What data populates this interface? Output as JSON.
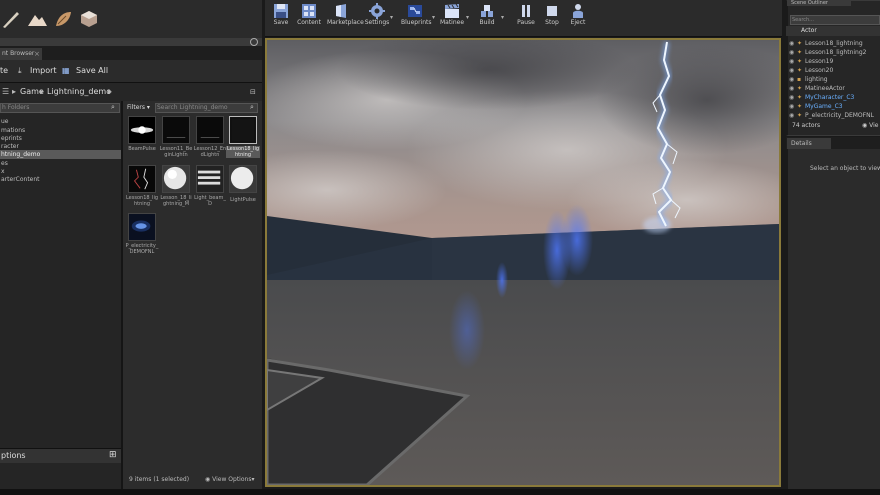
{
  "content_browser": {
    "tab_title": "nt Browser",
    "toolbar": {
      "add_new": "te",
      "import": "Import",
      "save_all": "Save All"
    },
    "path": {
      "root": "Game",
      "folder": "Lightning_demo"
    },
    "folder_search_placeholder": "h Folders",
    "folders": [
      "ue",
      "mations",
      "eprints",
      "racter",
      "htning_demo",
      "es",
      "x",
      "arterContent"
    ],
    "selected_folder_index": 4,
    "collections_label": "ptions",
    "filters_label": "Filters",
    "asset_search_placeholder": "Search Lightning_demo",
    "assets": [
      {
        "label": "BeamPulse"
      },
      {
        "label": "Lesson11_BeginLightn"
      },
      {
        "label": "Lesson12_EndLightn"
      },
      {
        "label": "Lesson18_lightning"
      },
      {
        "label": "Lesson18_lightning"
      },
      {
        "label": "Lesson_18_lightning_M"
      },
      {
        "label": "Light_beam_D"
      },
      {
        "label": "LightPulse"
      },
      {
        "label": "P_electricity_DEMOFNL"
      }
    ],
    "selected_asset_index": 3,
    "status": "9 items (1 selected)",
    "view_options": "View Options"
  },
  "main_toolbar": {
    "buttons": [
      {
        "label": "Save",
        "icon": "save-icon"
      },
      {
        "label": "Content",
        "icon": "content-icon"
      },
      {
        "label": "Marketplace",
        "icon": "marketplace-icon"
      },
      {
        "label": "Settings",
        "icon": "gear-icon"
      },
      {
        "label": "Blueprints",
        "icon": "blueprint-icon"
      },
      {
        "label": "Matinee",
        "icon": "clapper-icon"
      },
      {
        "label": "Build",
        "icon": "build-icon"
      },
      {
        "label": "Pause",
        "icon": "pause-icon"
      },
      {
        "label": "Stop",
        "icon": "stop-icon"
      },
      {
        "label": "Eject",
        "icon": "eject-icon"
      }
    ]
  },
  "outliner": {
    "tab_title": "Scene Outliner",
    "search_placeholder": "Search...",
    "column_actor": "Actor",
    "actors": [
      {
        "name": "Lesson18_lightning",
        "highlight": false
      },
      {
        "name": "Lesson18_lightning2",
        "highlight": false
      },
      {
        "name": "Lesson19",
        "highlight": false
      },
      {
        "name": "Lesson20",
        "highlight": false
      },
      {
        "name": "lighting",
        "highlight": false
      },
      {
        "name": "MatineeActor",
        "highlight": false
      },
      {
        "name": "MyCharacter_C3",
        "highlight": true
      },
      {
        "name": "MyGame_C3",
        "highlight": true
      },
      {
        "name": "P_electricity_DEMOFNL",
        "highlight": false
      }
    ],
    "actor_count": "74 actors",
    "view_label": "Vie"
  },
  "details": {
    "tab_title": "Details",
    "empty_message": "Select an object to view de"
  },
  "colors": {
    "viewport_border": "#8a7a3a",
    "highlight_actor": "#6ab0ff",
    "lightning": "#e8f4ff"
  }
}
